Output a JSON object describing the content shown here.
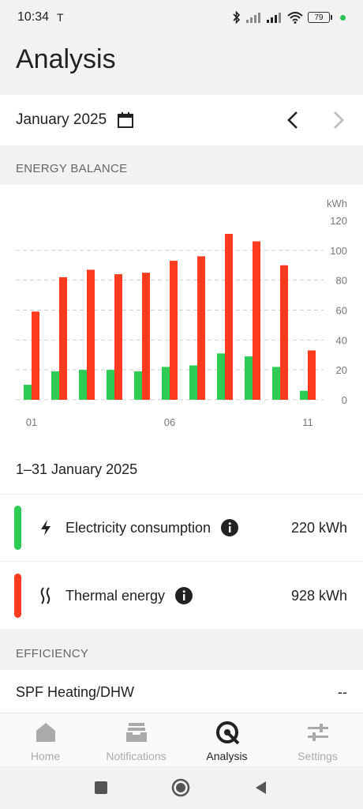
{
  "status": {
    "time": "10:34",
    "tesla_glyph": "T",
    "battery": "79"
  },
  "page_title": "Analysis",
  "month": {
    "label": "January 2025"
  },
  "sections": {
    "energy_balance": "ENERGY BALANCE",
    "efficiency": "EFFICIENCY"
  },
  "colors": {
    "electricity": "#2ecc55",
    "thermal": "#ff3b1f"
  },
  "chart_data": {
    "type": "bar",
    "categories": [
      "01",
      "02",
      "03",
      "04",
      "05",
      "06",
      "07",
      "08",
      "09",
      "10",
      "11"
    ],
    "tick_labels": [
      "01",
      "06",
      "11"
    ],
    "ylabel": "kWh",
    "ylim": [
      0,
      120
    ],
    "yticks": [
      0,
      20,
      40,
      60,
      80,
      100,
      120
    ],
    "series": [
      {
        "name": "Electricity consumption",
        "color": "#2ecc55",
        "values": [
          10,
          19,
          20,
          20,
          19,
          22,
          23,
          31,
          29,
          22,
          6
        ]
      },
      {
        "name": "Thermal energy",
        "color": "#ff3b1f",
        "values": [
          59,
          82,
          87,
          84,
          85,
          93,
          96,
          111,
          106,
          90,
          33
        ]
      }
    ]
  },
  "period": "1–31 January 2025",
  "metrics": [
    {
      "label": "Electricity consumption",
      "value": "220 kWh"
    },
    {
      "label": "Thermal energy",
      "value": "928 kWh"
    }
  ],
  "efficiency": {
    "label": "SPF Heating/DHW",
    "value": "--"
  },
  "bottom_nav": [
    {
      "label": "Home"
    },
    {
      "label": "Notifications"
    },
    {
      "label": "Analysis"
    },
    {
      "label": "Settings"
    }
  ]
}
